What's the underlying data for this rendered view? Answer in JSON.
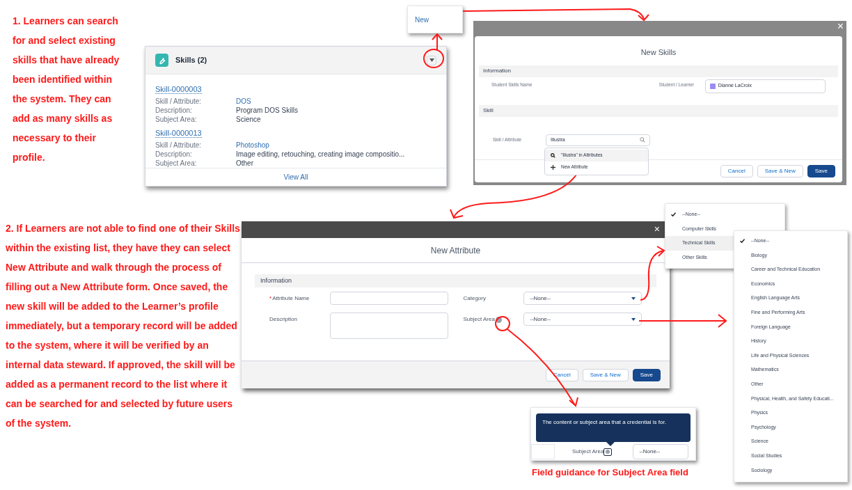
{
  "note_1": "1. Learners can search for and select existing skills that have already been identified within the system. They can add as many skills as necessary to their profile.",
  "note_2": "2. If Learners are not able to find one of their Skills within the existing list, they have they can select New Attribute and walk through the process of filling out a New Attribute form. Once saved, the new skill will be added to the Learner’s profile immediately, but a temporary record will be added to the system, where it will be verified by an internal data steward. If approved, the skill will be added as a permanent record to the list where it can be searched for and selected by future users of the system.",
  "new_menu": {
    "items": [
      "New"
    ]
  },
  "skills_card": {
    "title": "Skills (2)",
    "records": [
      {
        "id": "Skill-0000003",
        "fields": [
          {
            "label": "Skill / Attribute:",
            "value": "DOS",
            "link": true
          },
          {
            "label": "Description:",
            "value": "Program DOS Skills",
            "link": false
          },
          {
            "label": "Subject Area:",
            "value": "Science",
            "link": false
          }
        ]
      },
      {
        "id": "Skill-0000013",
        "fields": [
          {
            "label": "Skill / Attribute:",
            "value": "Photoshop",
            "link": true
          },
          {
            "label": "Description:",
            "value": "Image editing, retouching, creating image compositio...",
            "link": false
          },
          {
            "label": "Subject Area:",
            "value": "Other",
            "link": false
          }
        ]
      }
    ],
    "footer_link": "View All"
  },
  "new_skills_modal": {
    "title": "New Skills",
    "close": "×",
    "sections": [
      "Information",
      "Skill"
    ],
    "student_skills_name_label": "Student Skills Name",
    "learner_label": "Student / Learner",
    "learner_value": "Dianne LaCroix",
    "skill_label": "Skill / Attribute",
    "skill_value": "Illustra",
    "suggestions": [
      {
        "kind": "search",
        "label": "\"Illustra\" in Attributes"
      },
      {
        "kind": "new",
        "label": "New Attribute"
      }
    ],
    "buttons": [
      {
        "label": "Cancel",
        "primary": false
      },
      {
        "label": "Save & New",
        "primary": false
      },
      {
        "label": "Save",
        "primary": true
      }
    ]
  },
  "new_attribute_modal": {
    "title": "New Attribute",
    "close": "×",
    "section": "Information",
    "required_mark": "*",
    "fields": [
      {
        "label": "Attribute Name",
        "required": true,
        "kind": "text"
      },
      {
        "label": "Description",
        "required": false,
        "kind": "textarea"
      },
      {
        "label": "Category",
        "required": false,
        "kind": "select",
        "value": "--None--"
      },
      {
        "label": "Subject Area",
        "required": false,
        "kind": "select",
        "value": "--None--",
        "help": true
      }
    ],
    "buttons": [
      {
        "label": "Cancel",
        "primary": false
      },
      {
        "label": "Save & New",
        "primary": false
      },
      {
        "label": "Save",
        "primary": true
      }
    ]
  },
  "category_dropdown": {
    "options": [
      {
        "label": "--None--",
        "selected": true,
        "highlighted": false
      },
      {
        "label": "Computer Skills",
        "selected": false,
        "highlighted": false
      },
      {
        "label": "Technical Skills",
        "selected": false,
        "highlighted": true
      },
      {
        "label": "Other Skills",
        "selected": false,
        "highlighted": false
      }
    ]
  },
  "subject_area_dropdown": {
    "options": [
      {
        "label": "--None--",
        "selected": true
      },
      {
        "label": "Biology",
        "selected": false
      },
      {
        "label": "Career and Technical Education",
        "selected": false
      },
      {
        "label": "Economics",
        "selected": false
      },
      {
        "label": "English Language Arts",
        "selected": false
      },
      {
        "label": "Fine and Performing Arts",
        "selected": false
      },
      {
        "label": "Foreign Language",
        "selected": false
      },
      {
        "label": "History",
        "selected": false
      },
      {
        "label": "Life and Physical Sciences",
        "selected": false
      },
      {
        "label": "Mathematics",
        "selected": false
      },
      {
        "label": "Other",
        "selected": false
      },
      {
        "label": "Physical, Health, and Safety Educati...",
        "selected": false
      },
      {
        "label": "Physics",
        "selected": false
      },
      {
        "label": "Psychology",
        "selected": false
      },
      {
        "label": "Science",
        "selected": false
      },
      {
        "label": "Social Studies",
        "selected": false
      },
      {
        "label": "Sociology",
        "selected": false
      }
    ]
  },
  "tooltip_detail": {
    "tooltip": "The content or subject area that a credential is for.",
    "label": "Subject Area",
    "value": "--None--"
  },
  "caption": "Field guidance for Subject Area field"
}
